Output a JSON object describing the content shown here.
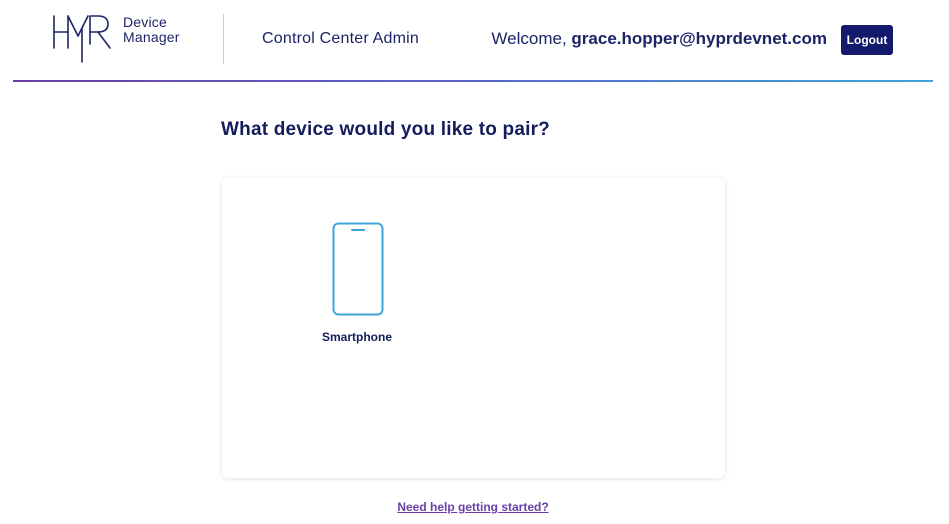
{
  "header": {
    "logo_text_line1": "Device",
    "logo_text_line2": "Manager",
    "app_title": "Control Center Admin",
    "welcome_prefix": "Welcome,",
    "user_email": "grace.hopper@hyprdevnet.com",
    "logout_label": "Logout"
  },
  "main": {
    "question": "What device would you like to pair?",
    "devices": [
      {
        "label": "Smartphone",
        "icon": "smartphone-icon"
      }
    ],
    "help_link": "Need help getting started?"
  },
  "colors": {
    "brand_navy": "#141a6b",
    "accent_purple": "#6b3fa6",
    "phone_icon_blue": "#3ea6d8"
  }
}
